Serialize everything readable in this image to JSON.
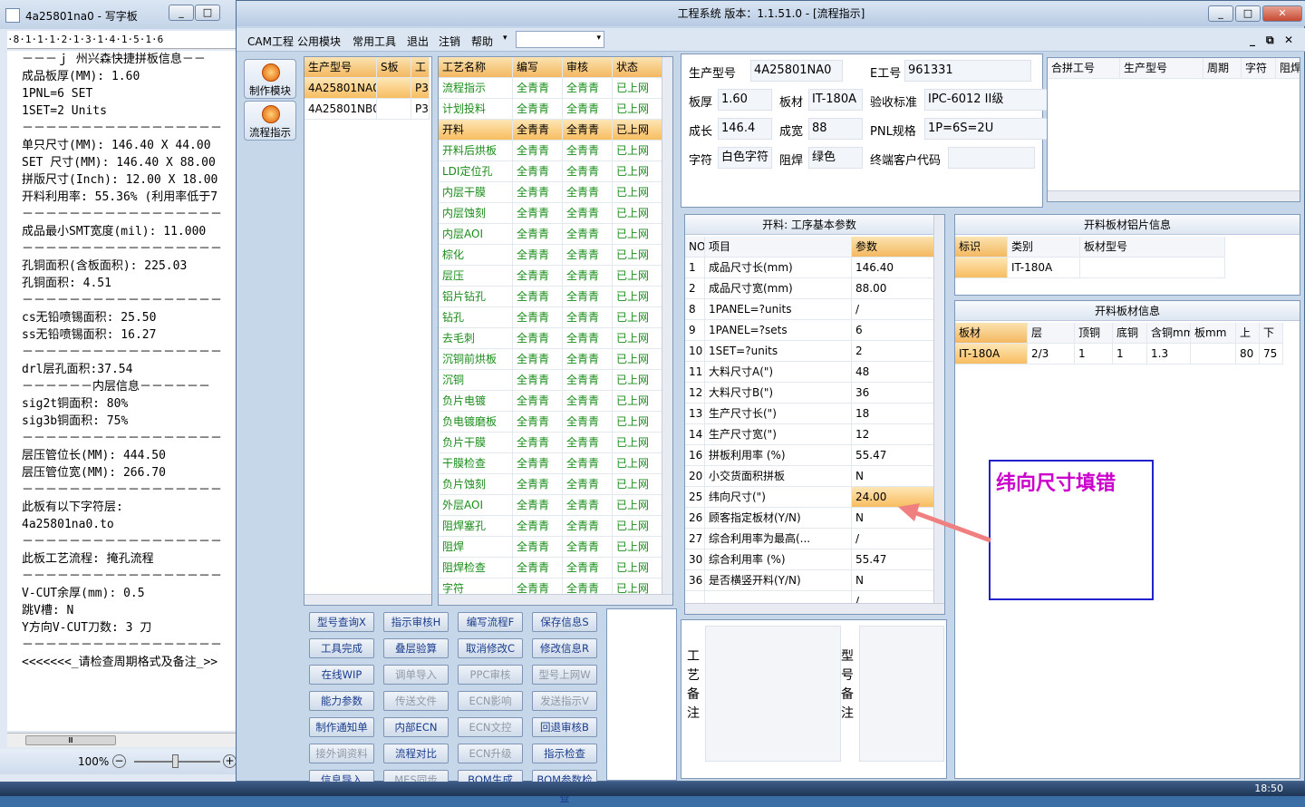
{
  "wordpad": {
    "title": "4a25801na0 - 写字板",
    "ruler": "·8·1·1·1·2·1·3·1·4·1·5·1·6",
    "lines": [
      "－－－ｊ 州兴森快捷拼板信息－－",
      "成品板厚(MM): 1.60",
      "1PNL=6 SET",
      "1SET=2 Units",
      "－－－－－－－－－－－－－－－－－",
      "单只尺寸(MM): 146.40 X 44.00",
      "SET 尺寸(MM): 146.40 X 88.00",
      "拼版尺寸(Inch): 12.00 X 18.00",
      "开料利用率: 55.36% (利用率低于7",
      "－－－－－－－－－－－－－－－－－",
      "成品最小SMT宽度(mil): 11.000",
      "－－－－－－－－－－－－－－－－－",
      "孔铜面积(含板面积): 225.03",
      "孔铜面积: 4.51",
      "－－－－－－－－－－－－－－－－－",
      "cs无铅喷锡面积: 25.50",
      "ss无铅喷锡面积: 16.27",
      "－－－－－－－－－－－－－－－－－",
      "drl层孔面积:37.54",
      "",
      "－－－－－－内层信息－－－－－－",
      "sig2t铜面积: 80%",
      "sig3b铜面积: 75%",
      "－－－－－－－－－－－－－－－－－",
      "层压管位长(MM): 444.50",
      "层压管位宽(MM): 266.70",
      "－－－－－－－－－－－－－－－－－",
      "此板有以下字符层:",
      "4a25801na0.to",
      "－－－－－－－－－－－－－－－－－",
      "此板工艺流程: 掩孔流程",
      "－－－－－－－－－－－－－－－－－",
      "V-CUT余厚(mm): 0.5",
      "跳V槽: N",
      "Y方向V-CUT刀数: 3 刀",
      "－－－－－－－－－－－－－－－－－",
      "<<<<<<<_请检查周期格式及备注_>>"
    ],
    "zoom": "100%",
    "zoom_out": "−",
    "zoom_in": "+",
    "hscroll_mark": "Ⅲ"
  },
  "app": {
    "title": "工程系统   版本：1.1.51.0 - [流程指示]",
    "menu": [
      "CAM工程",
      "公用模块",
      "常用工具",
      "退出",
      "注销",
      "帮助"
    ],
    "side_buttons": [
      "制作模块",
      "流程指示"
    ],
    "model_grid": {
      "headers": [
        "生产型号",
        "S板",
        "工"
      ],
      "rows": [
        [
          "4A25801NA0",
          "",
          "P3"
        ],
        [
          "4A25801NB0",
          "",
          "P3"
        ]
      ]
    },
    "process_grid": {
      "headers": [
        "工艺名称",
        "编写",
        "审核",
        "状态"
      ],
      "rows": [
        [
          "流程指示",
          "全青青",
          "全青青",
          "已上网"
        ],
        [
          "计划投料",
          "全青青",
          "全青青",
          "已上网"
        ],
        [
          "开料",
          "全青青",
          "全青青",
          "已上网"
        ],
        [
          "开料后烘板",
          "全青青",
          "全青青",
          "已上网"
        ],
        [
          "LDI定位孔",
          "全青青",
          "全青青",
          "已上网"
        ],
        [
          "内层干膜",
          "全青青",
          "全青青",
          "已上网"
        ],
        [
          "内层蚀刻",
          "全青青",
          "全青青",
          "已上网"
        ],
        [
          "内层AOI",
          "全青青",
          "全青青",
          "已上网"
        ],
        [
          "棕化",
          "全青青",
          "全青青",
          "已上网"
        ],
        [
          "层压",
          "全青青",
          "全青青",
          "已上网"
        ],
        [
          "铝片钻孔",
          "全青青",
          "全青青",
          "已上网"
        ],
        [
          "钻孔",
          "全青青",
          "全青青",
          "已上网"
        ],
        [
          "去毛刺",
          "全青青",
          "全青青",
          "已上网"
        ],
        [
          "沉铜前烘板",
          "全青青",
          "全青青",
          "已上网"
        ],
        [
          "沉铜",
          "全青青",
          "全青青",
          "已上网"
        ],
        [
          "负片电镀",
          "全青青",
          "全青青",
          "已上网"
        ],
        [
          "负电镀磨板",
          "全青青",
          "全青青",
          "已上网"
        ],
        [
          "负片干膜",
          "全青青",
          "全青青",
          "已上网"
        ],
        [
          "干膜检查",
          "全青青",
          "全青青",
          "已上网"
        ],
        [
          "负片蚀刻",
          "全青青",
          "全青青",
          "已上网"
        ],
        [
          "外层AOI",
          "全青青",
          "全青青",
          "已上网"
        ],
        [
          "阻焊塞孔",
          "全青青",
          "全青青",
          "已上网"
        ],
        [
          "阻焊",
          "全青青",
          "全青青",
          "已上网"
        ],
        [
          "阻焊检查",
          "全青青",
          "全青青",
          "已上网"
        ],
        [
          "字符",
          "全青青",
          "全青青",
          "已上网"
        ]
      ]
    },
    "info": {
      "r1": [
        [
          "生产型号",
          "4A25801NA0"
        ],
        [
          "E工号",
          "961331"
        ]
      ],
      "r2": [
        [
          "板厚",
          "1.60"
        ],
        [
          "板材",
          "IT-180A"
        ],
        [
          "验收标准",
          "IPC-6012 II级"
        ]
      ],
      "r3": [
        [
          "成长",
          "146.4"
        ],
        [
          "成宽",
          "88"
        ],
        [
          "PNL规格",
          "1P=6S=2U"
        ]
      ],
      "r4": [
        [
          "字符",
          "白色字符"
        ],
        [
          "阻焊",
          "绿色"
        ],
        [
          "终端客户代码",
          ""
        ]
      ]
    },
    "merge_grid": {
      "headers": [
        "合拼工号",
        "生产型号",
        "周期",
        "字符",
        "阻焊"
      ]
    },
    "params": {
      "title": "开料: 工序基本参数",
      "headers": [
        "NO",
        "项目",
        "参数"
      ],
      "rows": [
        [
          "1",
          "成品尺寸长(mm)",
          "146.40"
        ],
        [
          "2",
          "成品尺寸宽(mm)",
          "88.00"
        ],
        [
          "8",
          "1PANEL=?units",
          "/"
        ],
        [
          "9",
          "1PANEL=?sets",
          "6"
        ],
        [
          "10",
          "1SET=?units",
          "2"
        ],
        [
          "11",
          "大料尺寸A(\")",
          "48"
        ],
        [
          "12",
          "大料尺寸B(\")",
          "36"
        ],
        [
          "13",
          "生产尺寸长(\")",
          "18"
        ],
        [
          "14",
          "生产尺寸宽(\")",
          "12"
        ],
        [
          "16",
          "拼板利用率 (%)",
          "55.47"
        ],
        [
          "20",
          "小交货面积拼板",
          "N"
        ],
        [
          "25",
          "纬向尺寸(\")",
          "24.00"
        ],
        [
          "26",
          "顾客指定板材(Y/N)",
          "N"
        ],
        [
          "27",
          "综合利用率为最高(...",
          "/"
        ],
        [
          "30",
          "综合利用率 (%)",
          "55.47"
        ],
        [
          "36",
          "是否横竖开料(Y/N)",
          "N"
        ],
        [
          "",
          "",
          "/"
        ]
      ]
    },
    "alu": {
      "title": "开料板材铝片信息",
      "headers": [
        "标识",
        "类别",
        "板材型号"
      ],
      "row": [
        "",
        "IT-180A",
        ""
      ]
    },
    "board": {
      "title": "开料板材信息",
      "headers": [
        "板材",
        "层",
        "顶铜",
        "底铜",
        "含铜mm",
        "板mm",
        "上",
        "下"
      ],
      "row": [
        "IT-180A",
        "2/3",
        "1",
        "1",
        "1.3",
        "",
        "80",
        "75"
      ]
    },
    "buttons": [
      [
        "型号查询X",
        "指示审核H",
        "编写流程F",
        "保存信息S"
      ],
      [
        "工具完成",
        "叠层验算",
        "取消修改C",
        "修改信息R"
      ],
      [
        "在线WIP",
        "调单导入",
        "PPC审核",
        "型号上网W"
      ],
      [
        "能力参数",
        "传送文件",
        "ECN影响",
        "发送指示V"
      ],
      [
        "制作通知单",
        "内部ECN",
        "ECN文控",
        "回退审核B"
      ],
      [
        "接外调资料",
        "流程对比",
        "ECN升级",
        "指示检查"
      ],
      [
        "信息导入",
        "MES同步",
        "BOM生成",
        "BOM参数检查"
      ]
    ],
    "disabled": [
      [
        2,
        1
      ],
      [
        2,
        2
      ],
      [
        2,
        3
      ],
      [
        3,
        1
      ],
      [
        3,
        2
      ],
      [
        3,
        3
      ],
      [
        4,
        2
      ],
      [
        5,
        0
      ],
      [
        5,
        2
      ],
      [
        6,
        1
      ]
    ],
    "remark_left": [
      "工",
      "艺",
      "备",
      "注"
    ],
    "remark_right": [
      "型",
      "号",
      "备",
      "注"
    ]
  },
  "annotation": {
    "text": "纬向尺寸填错",
    "color": "#cc00cc"
  },
  "taskbar": {
    "clock": "18:50"
  }
}
